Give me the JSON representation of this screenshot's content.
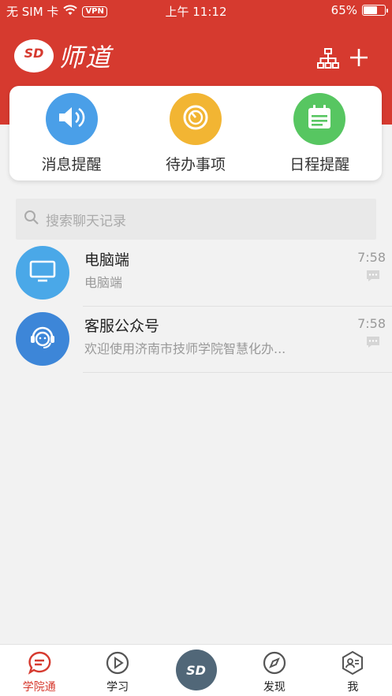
{
  "status_bar": {
    "carrier": "无 SIM 卡",
    "vpn": "VPN",
    "time": "上午 11:12",
    "battery": "65%",
    "battery_level": 0.65
  },
  "header": {
    "logo_badge": "SD",
    "logo_text": "师道"
  },
  "shortcuts": [
    {
      "label": "消息提醒",
      "color": "#4a9fe8",
      "icon": "speaker-icon"
    },
    {
      "label": "待办事项",
      "color": "#f2b533",
      "icon": "timer-icon"
    },
    {
      "label": "日程提醒",
      "color": "#57c661",
      "icon": "calendar-icon"
    }
  ],
  "search": {
    "placeholder": "搜索聊天记录"
  },
  "conversations": [
    {
      "title": "电脑端",
      "subtitle": "电脑端",
      "time": "7:58",
      "avatar_color": "#4aa8e8",
      "icon": "monitor-icon"
    },
    {
      "title": "客服公众号",
      "subtitle": "欢迎使用济南市技师学院智慧化办...",
      "time": "7:58",
      "avatar_color": "#3d86d8",
      "icon": "support-agent-icon"
    }
  ],
  "bottom_nav": [
    {
      "label": "学院通",
      "active": true,
      "icon": "chat-icon"
    },
    {
      "label": "学习",
      "active": false,
      "icon": "play-icon"
    },
    {
      "label": "",
      "active": false,
      "icon": "sd-logo-icon",
      "badge": "SD"
    },
    {
      "label": "发现",
      "active": false,
      "icon": "compass-icon"
    },
    {
      "label": "我",
      "active": false,
      "icon": "profile-icon"
    }
  ],
  "colors": {
    "brand_red": "#d63a2f",
    "background": "#f2f2f2"
  }
}
